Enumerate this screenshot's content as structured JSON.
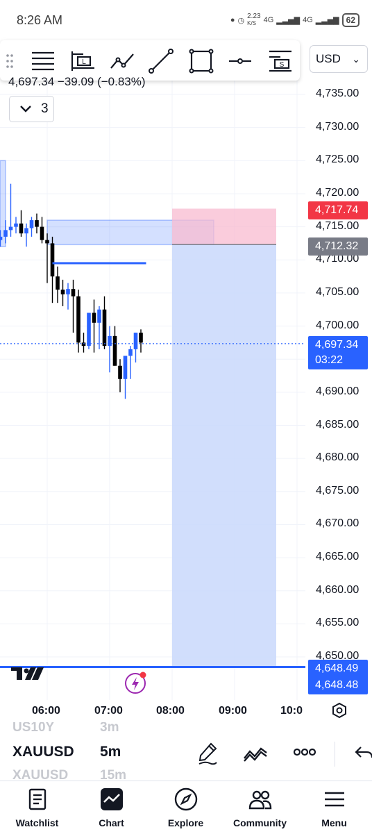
{
  "status_bar": {
    "time": "8:26 AM",
    "net_speed_value": "2.23",
    "net_speed_unit": "K/S",
    "network_1": "4G",
    "network_2": "4G",
    "battery": "62"
  },
  "currency": {
    "selected": "USD"
  },
  "legend": {
    "ohlc_text": "4,697.34  −39.09 (−0.83%)",
    "indicators_count": "3"
  },
  "price_axis": {
    "labels": [
      "4,735.00",
      "4,730.00",
      "4,725.00",
      "4,720.00",
      "4,715.00",
      "4,710.00",
      "4,705.00",
      "4,700.00",
      "4,690.00",
      "4,685.00",
      "4,680.00",
      "4,675.00",
      "4,670.00",
      "4,665.00",
      "4,660.00",
      "4,655.00",
      "4,650.00"
    ],
    "stop_price": "4,717.74",
    "entry_price": "4,712.32",
    "current_price": "4,697.34",
    "countdown": "03:22",
    "target_price_1": "4,648.49",
    "target_price_2": "4,648.48"
  },
  "time_axis": {
    "labels": [
      "06:00",
      "07:00",
      "08:00",
      "09:00",
      "10:0"
    ]
  },
  "colors": {
    "candle_up": "#2962ff",
    "candle_down": "#000000",
    "stop_zone": "#f8bbd0",
    "target_zone": "#c9d8fb",
    "stop_badge": "#f23645",
    "entry_badge": "#787b86",
    "price_badge": "#2962ff"
  },
  "chart_data": {
    "type": "candlestick",
    "symbol": "XAUUSD",
    "interval": "5m",
    "x": [
      "05:15",
      "05:20",
      "05:25",
      "05:30",
      "05:35",
      "05:40",
      "05:45",
      "05:50",
      "05:55",
      "06:00",
      "06:05",
      "06:10",
      "06:15",
      "06:20",
      "06:25",
      "06:30",
      "06:35",
      "06:40",
      "06:45",
      "06:50",
      "06:55",
      "07:00",
      "07:05",
      "07:10",
      "07:15",
      "07:20",
      "07:25",
      "07:30"
    ],
    "open": [
      4713.0,
      4713.5,
      4714.5,
      4715.0,
      4715.5,
      4714.0,
      4714.8,
      4716.0,
      4715.0,
      4713.0,
      4712.5,
      4707.5,
      4705.5,
      4704.8,
      4705.6,
      4704.5,
      4697.5,
      4697.0,
      4702.0,
      4700.5,
      4702.5,
      4697.0,
      4698.5,
      4694.0,
      4692.0,
      4695.5,
      4696.5,
      4699.0
    ],
    "high": [
      4714.5,
      4716.0,
      4721.5,
      4716.5,
      4717.5,
      4715.5,
      4716.5,
      4717.0,
      4716.5,
      4714.0,
      4713.5,
      4709.0,
      4707.0,
      4706.5,
      4707.0,
      4705.5,
      4699.0,
      4702.0,
      4704.0,
      4703.0,
      4704.5,
      4700.0,
      4700.0,
      4695.0,
      4694.0,
      4697.0,
      4699.0,
      4699.5
    ],
    "low": [
      4712.0,
      4712.5,
      4713.5,
      4714.0,
      4713.5,
      4712.0,
      4713.5,
      4714.0,
      4712.5,
      4706.5,
      4703.5,
      4703.5,
      4703.0,
      4702.5,
      4699.0,
      4696.0,
      4696.0,
      4696.5,
      4696.0,
      4696.5,
      4696.5,
      4693.0,
      4694.0,
      4690.0,
      4689.0,
      4692.0,
      4694.5,
      4696.0
    ],
    "close": [
      4713.5,
      4714.5,
      4715.0,
      4715.5,
      4714.0,
      4714.8,
      4716.0,
      4715.0,
      4713.0,
      4712.5,
      4707.5,
      4705.5,
      4704.8,
      4705.6,
      4704.5,
      4697.5,
      4697.0,
      4702.0,
      4700.5,
      4702.5,
      4697.0,
      4698.5,
      4694.0,
      4692.0,
      4695.5,
      4696.5,
      4699.0,
      4697.5
    ],
    "ylim": [
      4645.0,
      4737.5
    ],
    "xlim": [
      "05:15",
      "10:10"
    ],
    "price_zones": [
      {
        "from": 4712.0,
        "to": 4725.0,
        "x_start": "05:00",
        "x_end": "05:20"
      },
      {
        "from": 4712.3,
        "to": 4716.0,
        "x_start": "06:00",
        "x_end": "08:40"
      }
    ],
    "horizontal_ray": {
      "price": 4709.5,
      "x_start": "06:05",
      "x_end": "07:35"
    },
    "position": {
      "type": "short",
      "entry": 4712.32,
      "stop": 4717.74,
      "target": 4648.49,
      "x_start": "08:00",
      "x_end": "09:40"
    },
    "last_price": 4697.34
  },
  "bottom_bar": {
    "ghost_prev_symbol": "US10Y",
    "ghost_prev_interval": "3m",
    "symbol": "XAUUSD",
    "interval": "5m",
    "ghost_next_symbol": "XAUUSD",
    "ghost_next_interval": "15m"
  },
  "nav": {
    "watchlist": "Watchlist",
    "chart": "Chart",
    "explore": "Explore",
    "community": "Community",
    "menu": "Menu"
  }
}
